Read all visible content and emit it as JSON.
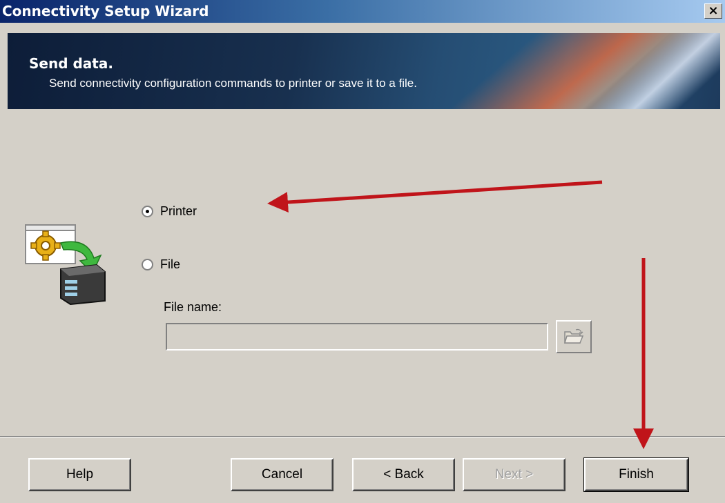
{
  "window": {
    "title": "Connectivity Setup Wizard",
    "close_label": "×"
  },
  "header": {
    "title": "Send data.",
    "subtitle": "Send connectivity configuration commands to printer or save it to a file."
  },
  "options": {
    "printer_label": "Printer",
    "printer_selected": true,
    "file_label": "File",
    "file_selected": false,
    "filename_label": "File name:",
    "filename_value": ""
  },
  "buttons": {
    "help": "Help",
    "cancel": "Cancel",
    "back": "< Back",
    "next": "Next >",
    "finish": "Finish"
  },
  "annotations": {
    "arrow_color": "#c0141a"
  },
  "icons": {
    "wizard": "config-to-printer-icon",
    "browse": "open-folder-icon",
    "close": "close-icon"
  }
}
